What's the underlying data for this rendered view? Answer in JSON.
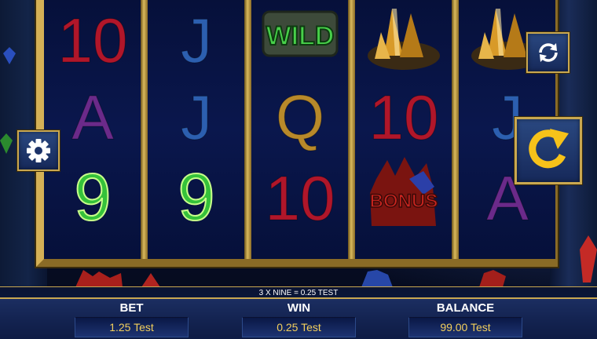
{
  "reels": [
    [
      "10",
      "A",
      "9"
    ],
    [
      "J",
      "J",
      "9"
    ],
    [
      "WILD",
      "Q",
      "10"
    ],
    [
      "crystal",
      "10",
      "BONUS"
    ],
    [
      "crystal",
      "J",
      "A"
    ]
  ],
  "symbol_colors": {
    "10": "#b0162a",
    "A": "#6b2a8a",
    "J": "#2c5fb0",
    "Q": "#b8892a",
    "9": "#35c23a",
    "WILD": "#48d04a",
    "BONUS": "#c8241f",
    "crystal": "#d89a28"
  },
  "buttons": {
    "autoplay_icon": "autoplay-icon",
    "settings_icon": "gear-icon",
    "spin_icon": "spin-icon"
  },
  "win_message": "3 X NINE = 0.25 TEST",
  "stats": {
    "bet_label": "BET",
    "bet_value": "1.25 Test",
    "win_label": "WIN",
    "win_value": "0.25 Test",
    "balance_label": "BALANCE",
    "balance_value": "99.00 Test"
  },
  "colors": {
    "frame_gold": "#c9a851",
    "value_text": "#f3cf5c",
    "panel_blue": "#1a2d63"
  }
}
